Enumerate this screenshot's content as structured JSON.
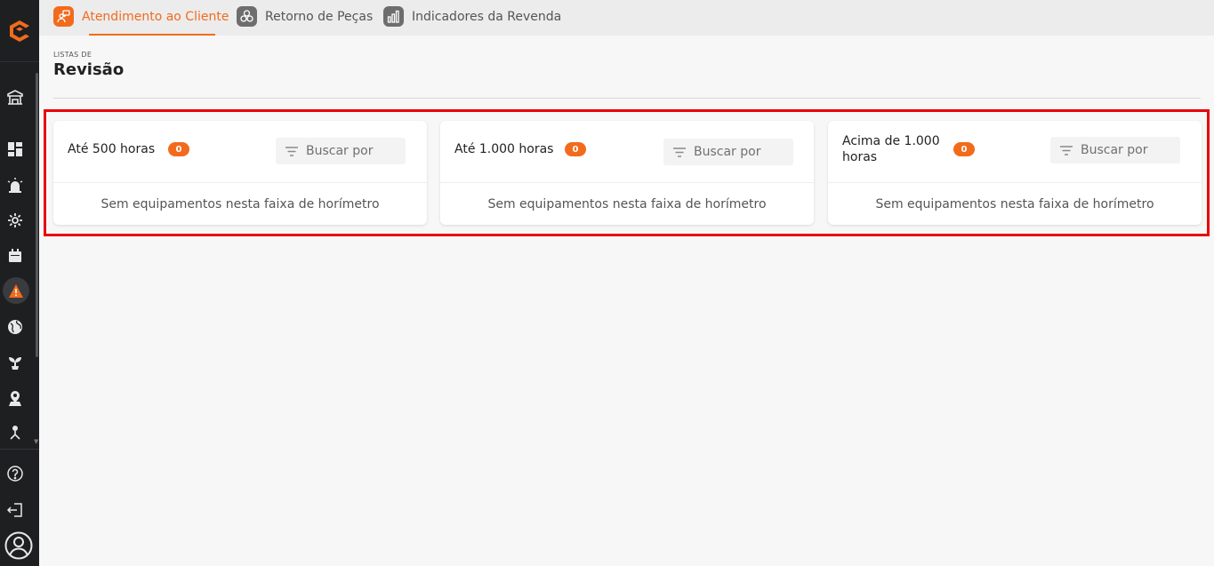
{
  "tabs": [
    {
      "label": "Atendimento ao Cliente",
      "active": true,
      "icon": "customer-chat-icon"
    },
    {
      "label": "Retorno de Peças",
      "active": false,
      "icon": "parts-return-icon"
    },
    {
      "label": "Indicadores da Revenda",
      "active": false,
      "icon": "bar-chart-icon"
    }
  ],
  "header": {
    "eyebrow": "LISTAS DE",
    "title": "Revisão"
  },
  "cards": [
    {
      "title": "Até 500 horas",
      "count": "0",
      "search_placeholder": "Buscar por",
      "empty_message": "Sem equipamentos nesta faixa de horímetro"
    },
    {
      "title": "Até 1.000 horas",
      "count": "0",
      "search_placeholder": "Buscar por",
      "empty_message": "Sem equipamentos nesta faixa de horímetro"
    },
    {
      "title": "Acima de 1.000 horas",
      "count": "0",
      "search_placeholder": "Buscar por",
      "empty_message": "Sem equipamentos nesta faixa de horímetro"
    }
  ],
  "sidebar": {
    "items": [
      "dealership-icon",
      "dashboard-icon",
      "alarm-icon",
      "settings-gear-icon",
      "calendar-icon",
      "warning-icon",
      "globe-icon",
      "plant-icon",
      "location-pin-icon",
      "organization-icon"
    ],
    "active_item": "warning-icon",
    "bottom": [
      "help-icon",
      "logout-icon",
      "user-avatar-icon"
    ]
  },
  "colors": {
    "accent": "#f26b1d",
    "sidebar": "#1e1f21",
    "highlight": "#e8000b"
  }
}
